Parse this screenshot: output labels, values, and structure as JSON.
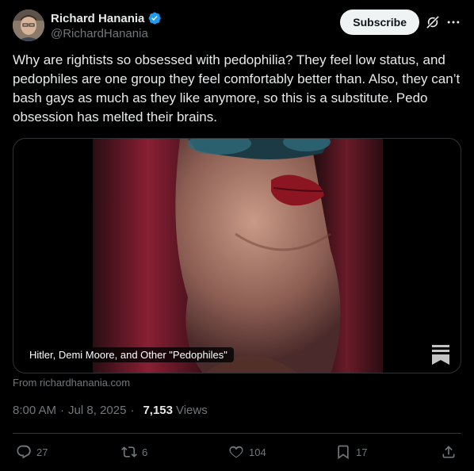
{
  "author": {
    "name": "Richard Hanania",
    "handle": "@RichardHanania"
  },
  "header": {
    "subscribe_label": "Subscribe"
  },
  "tweet": {
    "text": "Why are rightists so obsessed with pedophilia? They feel low status, and pedophiles are one group they feel comfortably better than. Also, they can’t bash gays as much as they like anymore, so this is a substitute. Pedo obsession has melted their brains."
  },
  "card": {
    "title": "Hitler, Demi Moore, and Other \"Pedophiles\"",
    "source": "From richardhanania.com"
  },
  "meta": {
    "time": "8:00 AM",
    "date": "Jul 8, 2025",
    "views_count": "7,153",
    "views_label": "Views"
  },
  "actions": {
    "replies": "27",
    "reposts": "6",
    "likes": "104",
    "bookmarks": "17"
  },
  "colors": {
    "background": "#000000",
    "text": "#e7e9ea",
    "muted": "#71767b",
    "verified": "#1d9bf0",
    "border": "#2f3336"
  },
  "icons": {
    "verified": "verified-badge-icon",
    "grok": "grok-icon",
    "more": "more-icon",
    "reply": "reply-icon",
    "repost": "repost-icon",
    "like": "heart-icon",
    "bookmark": "bookmark-icon",
    "share": "share-icon",
    "card_logo": "substack-logo-icon"
  }
}
